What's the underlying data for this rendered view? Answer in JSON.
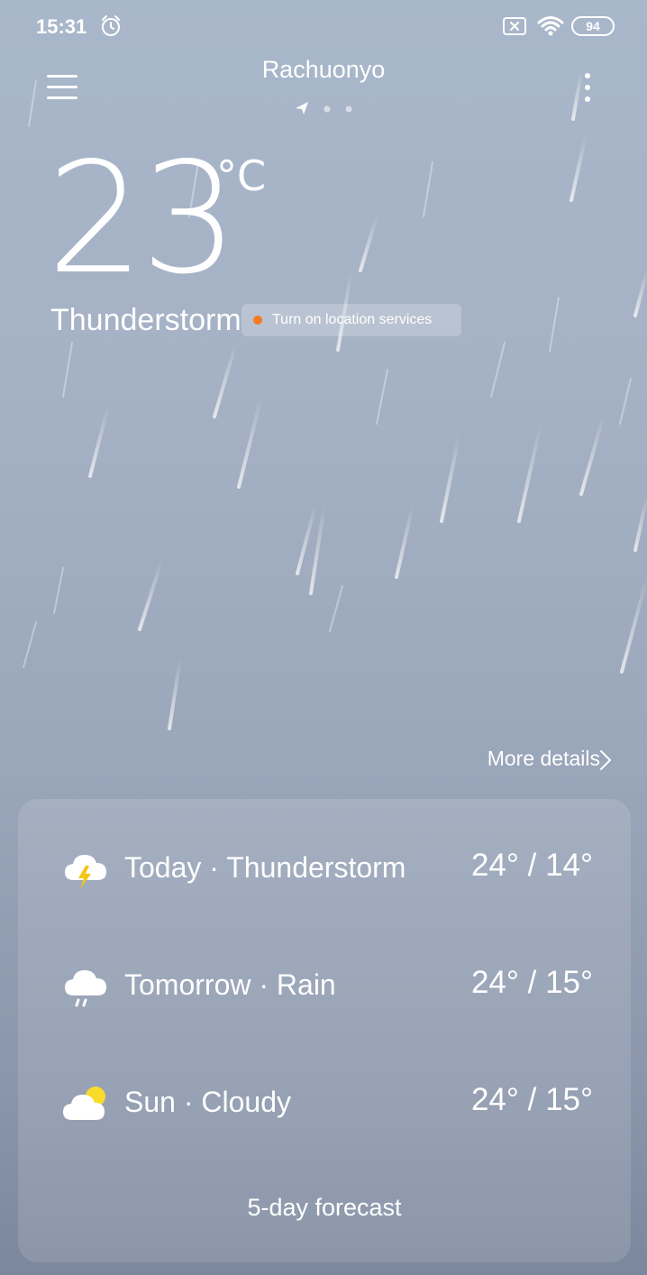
{
  "status_bar": {
    "time": "15:31",
    "battery": "94",
    "icons": [
      "alarm-icon",
      "no-sim-icon",
      "wifi-icon",
      "battery-icon"
    ]
  },
  "header": {
    "city": "Rachuonyo",
    "menu_icon": "menu-icon",
    "more_icon": "more-vertical-icon"
  },
  "current": {
    "temperature": "23",
    "unit": "°C",
    "condition": "Thunderstorm",
    "location_notice": "Turn on location services",
    "more_details": "More details"
  },
  "forecast": {
    "days": [
      {
        "label": "Today · Thunderstorm",
        "temps": "24° / 14°",
        "icon": "thunderstorm-icon"
      },
      {
        "label": "Tomorrow · Rain",
        "temps": "24° / 15°",
        "icon": "rain-icon"
      },
      {
        "label": "Sun · Cloudy",
        "temps": "24° / 15°",
        "icon": "partly-cloudy-icon"
      }
    ],
    "button_label": "5-day forecast"
  },
  "colors": {
    "accent_dot": "#f57a22",
    "bolt": "#f5c518",
    "sun": "#f7dc2c"
  }
}
